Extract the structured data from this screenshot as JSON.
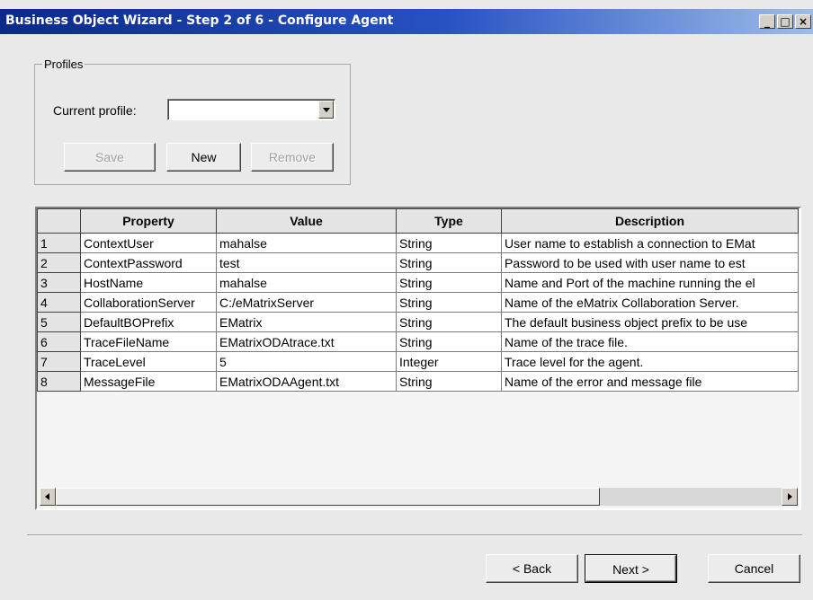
{
  "window": {
    "title": "Business Object Wizard - Step 2 of 6 - Configure Agent",
    "controls": [
      "minimize-icon",
      "maximize-icon",
      "close-icon"
    ]
  },
  "profiles": {
    "legend": "Profiles",
    "current_profile_label": "Current profile:",
    "current_profile_value": "",
    "save_label": "Save",
    "new_label": "New",
    "remove_label": "Remove"
  },
  "grid": {
    "columns": [
      "",
      "Property",
      "Value",
      "Type",
      "Description"
    ],
    "rows": [
      {
        "num": "1",
        "property": "ContextUser",
        "value": "mahalse",
        "type": "String",
        "description": "User name to establish a connection to EMat"
      },
      {
        "num": "2",
        "property": "ContextPassword",
        "value": "test",
        "type": "String",
        "description": "Password to be used with user name to est"
      },
      {
        "num": "3",
        "property": "HostName",
        "value": "mahalse",
        "type": "String",
        "description": "Name and Port of the machine running the el"
      },
      {
        "num": "4",
        "property": "CollaborationServer",
        "value": "C:/eMatrixServer",
        "type": "String",
        "description": "Name of the eMatrix Collaboration Server."
      },
      {
        "num": "5",
        "property": "DefaultBOPrefix",
        "value": "EMatrix",
        "type": "String",
        "description": "The default business object prefix to be use"
      },
      {
        "num": "6",
        "property": "TraceFileName",
        "value": "EMatrixODAtrace.txt",
        "type": "String",
        "description": "Name of the trace file."
      },
      {
        "num": "7",
        "property": "TraceLevel",
        "value": "5",
        "type": "Integer",
        "description": "Trace level for the agent."
      },
      {
        "num": "8",
        "property": "MessageFile",
        "value": "EMatrixODAAgent.txt",
        "type": "String",
        "description": "Name of the error and message file"
      }
    ]
  },
  "footer": {
    "back_label": "< Back",
    "next_label": "Next >",
    "cancel_label": "Cancel"
  },
  "colors": {
    "title_bar_start": "#0b2a88",
    "title_bar_end": "#9dbde9",
    "dialog_background": "#e9e9e9"
  }
}
